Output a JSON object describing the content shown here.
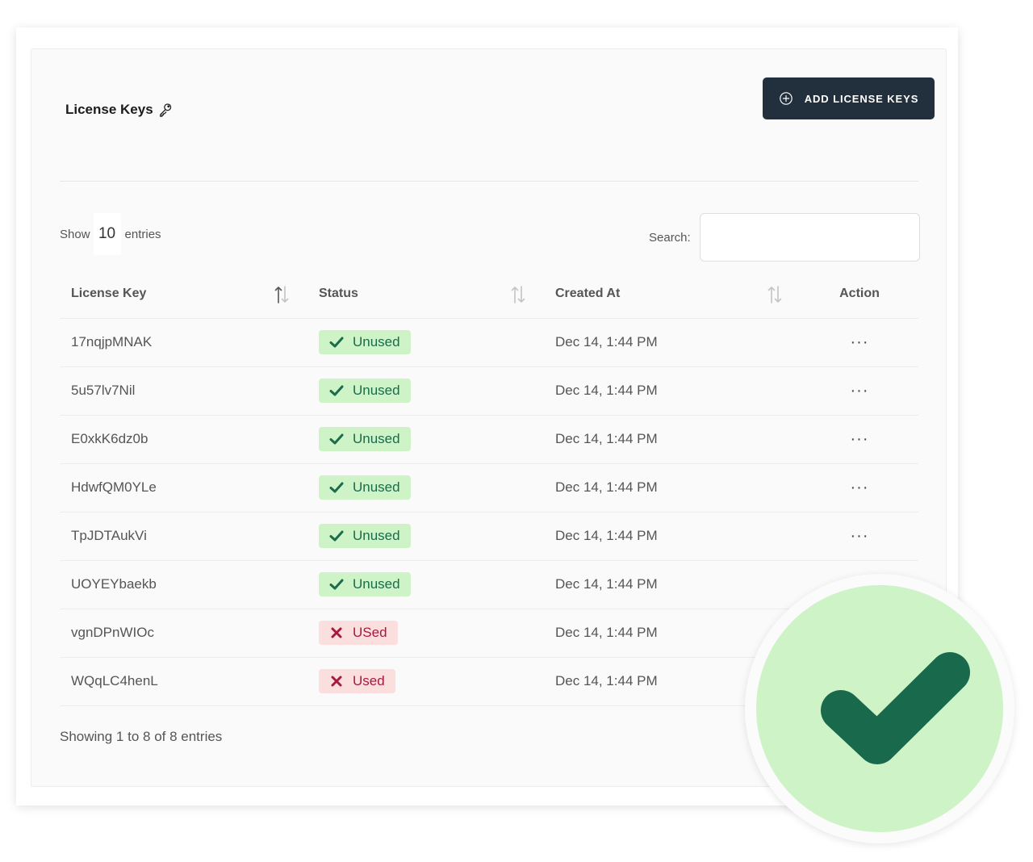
{
  "header": {
    "title": "License Keys",
    "add_button_label": "ADD LICENSE KEYS"
  },
  "controls": {
    "show_label": "Show",
    "page_length": "10",
    "entries_label": "entries",
    "search_label": "Search:",
    "search_value": ""
  },
  "table": {
    "columns": [
      "License Key",
      "Status",
      "Created At",
      "Action"
    ],
    "rows": [
      {
        "key": "17nqjpMNAK",
        "status": "Unused",
        "created": "Dec 14, 1:44 PM",
        "action": "···"
      },
      {
        "key": "5u57lv7Nil",
        "status": "Unused",
        "created": "Dec 14, 1:44 PM",
        "action": "···"
      },
      {
        "key": "E0xkK6dz0b",
        "status": "Unused",
        "created": "Dec 14, 1:44 PM",
        "action": "···"
      },
      {
        "key": "HdwfQM0YLe",
        "status": "Unused",
        "created": "Dec 14, 1:44 PM",
        "action": "···"
      },
      {
        "key": "TpJDTAukVi",
        "status": "Unused",
        "created": "Dec 14, 1:44 PM",
        "action": "···"
      },
      {
        "key": "UOYEYbaekb",
        "status": "Unused",
        "created": "Dec 14, 1:44 PM",
        "action": ""
      },
      {
        "key": "vgnDPnWIOc",
        "status": "USed",
        "created": "Dec 14, 1:44 PM",
        "action": ""
      },
      {
        "key": "WQqLC4henL",
        "status": "Used",
        "created": "Dec 14, 1:44 PM",
        "action": ""
      }
    ]
  },
  "footer": {
    "info": "Showing 1 to 8 of 8 entries"
  },
  "icons": {
    "title": "key-icon",
    "add_button": "plus-circle-icon",
    "sort": "sort-arrows-icon",
    "unused_status": "check-icon",
    "used_status": "x-icon",
    "overlay": "large-check-icon"
  },
  "colors": {
    "button_bg": "#222f3c",
    "unused_bg": "#cdf3c6",
    "unused_text": "#1b6b4d",
    "used_bg": "#fbdede",
    "used_text": "#a8193f",
    "check_dark": "#19694d"
  }
}
